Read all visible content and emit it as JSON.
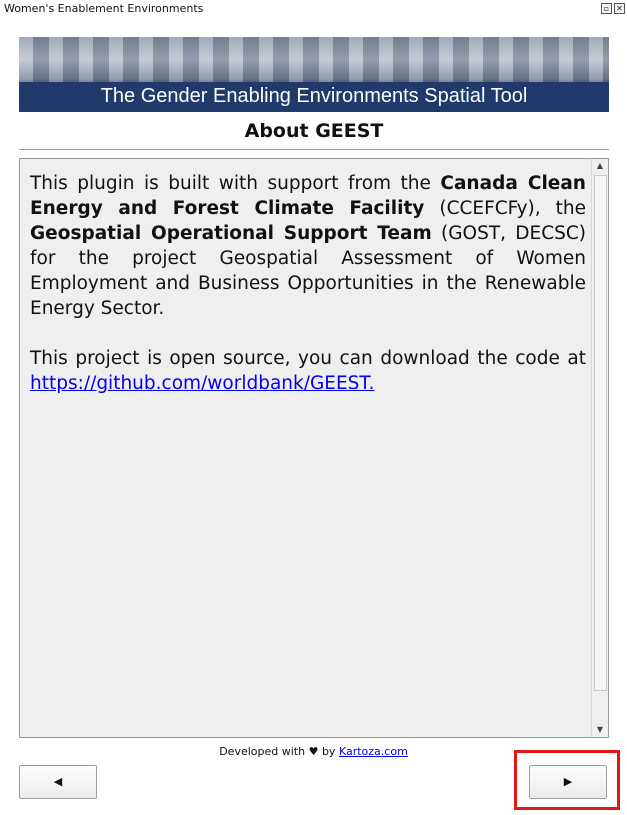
{
  "window": {
    "title": "Women's Enablement Environments",
    "float_glyph": "▫",
    "close_glyph": "✕"
  },
  "banner": {
    "text": "The Gender Enabling Environments Spatial Tool"
  },
  "page": {
    "heading": "About GEEST"
  },
  "about": {
    "p1_part1": "This plugin is built with support from the ",
    "org1": "Canada Clean Energy and Forest Climate Facility",
    "p1_part2": " (CCEFCFy), the ",
    "org2": "Geospatial Operational Support Team",
    "p1_part3": " (GOST, DECSC) for the project Geospatial Assessment of Women Employment and Business Opportunities in the Renewable Energy Sector.",
    "p2_text": "This project is open source, you can download the code at ",
    "repo_link": "https://github.com/worldbank/GEEST."
  },
  "scrollbar": {
    "up_glyph": "▲",
    "down_glyph": "▼"
  },
  "footer": {
    "prefix": "Developed with ",
    "heart": "♥",
    "by": " by ",
    "link": "Kartoza.com"
  },
  "nav": {
    "prev_glyph": "◀",
    "next_glyph": "▶"
  },
  "colors": {
    "banner_band": "#1f3a6b",
    "link": "#0000ee",
    "highlight": "#e01818"
  }
}
